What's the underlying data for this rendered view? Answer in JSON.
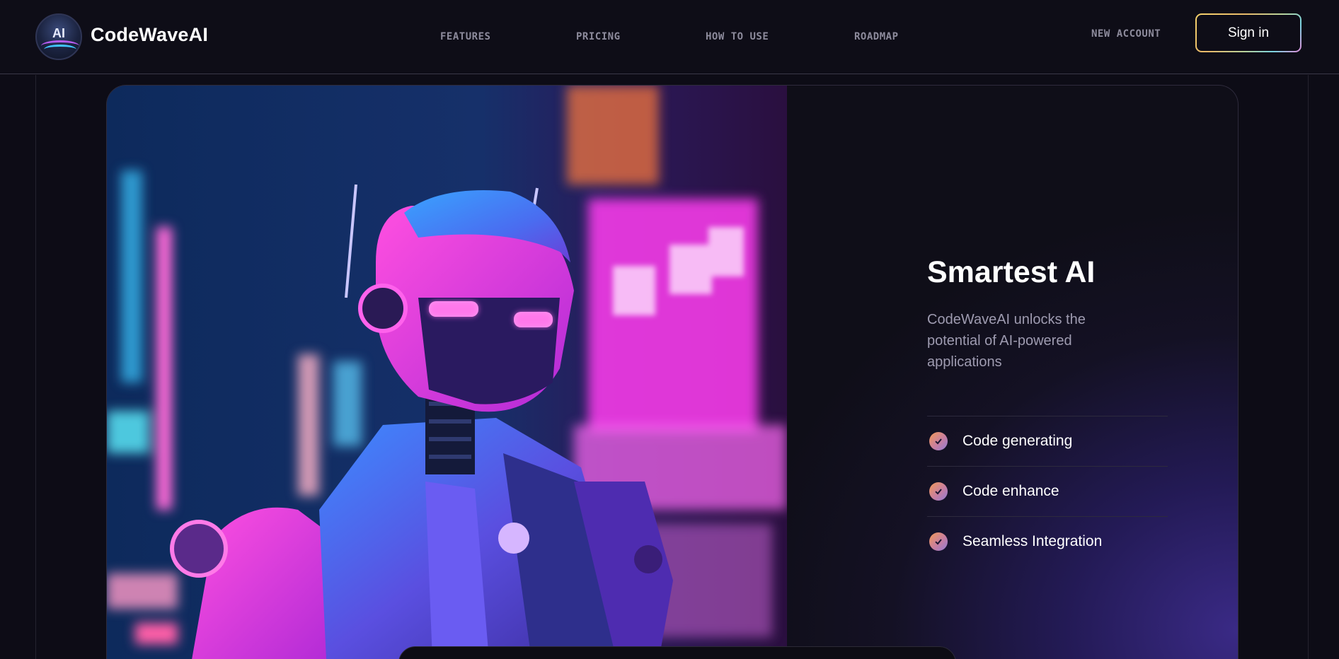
{
  "header": {
    "brand": "CodeWaveAI",
    "logo_text": "AI",
    "nav": [
      "FEATURES",
      "PRICING",
      "HOW TO USE",
      "ROADMAP"
    ],
    "new_account": "NEW ACCOUNT",
    "sign_in": "Sign in"
  },
  "hero": {
    "image_alt": "neon-robot-illustration",
    "title": "Smartest AI",
    "description": "CodeWaveAI unlocks the potential of AI-powered applications",
    "features": [
      {
        "label": "Code generating",
        "icon": "check-icon"
      },
      {
        "label": "Code enhance",
        "icon": "check-icon"
      },
      {
        "label": "Seamless Integration",
        "icon": "check-icon"
      }
    ]
  },
  "colors": {
    "background": "#0d0c16",
    "accent_gradient_start": "#f29a56",
    "accent_gradient_end": "#8f7cd6",
    "card_glow": "#3a2a86"
  }
}
